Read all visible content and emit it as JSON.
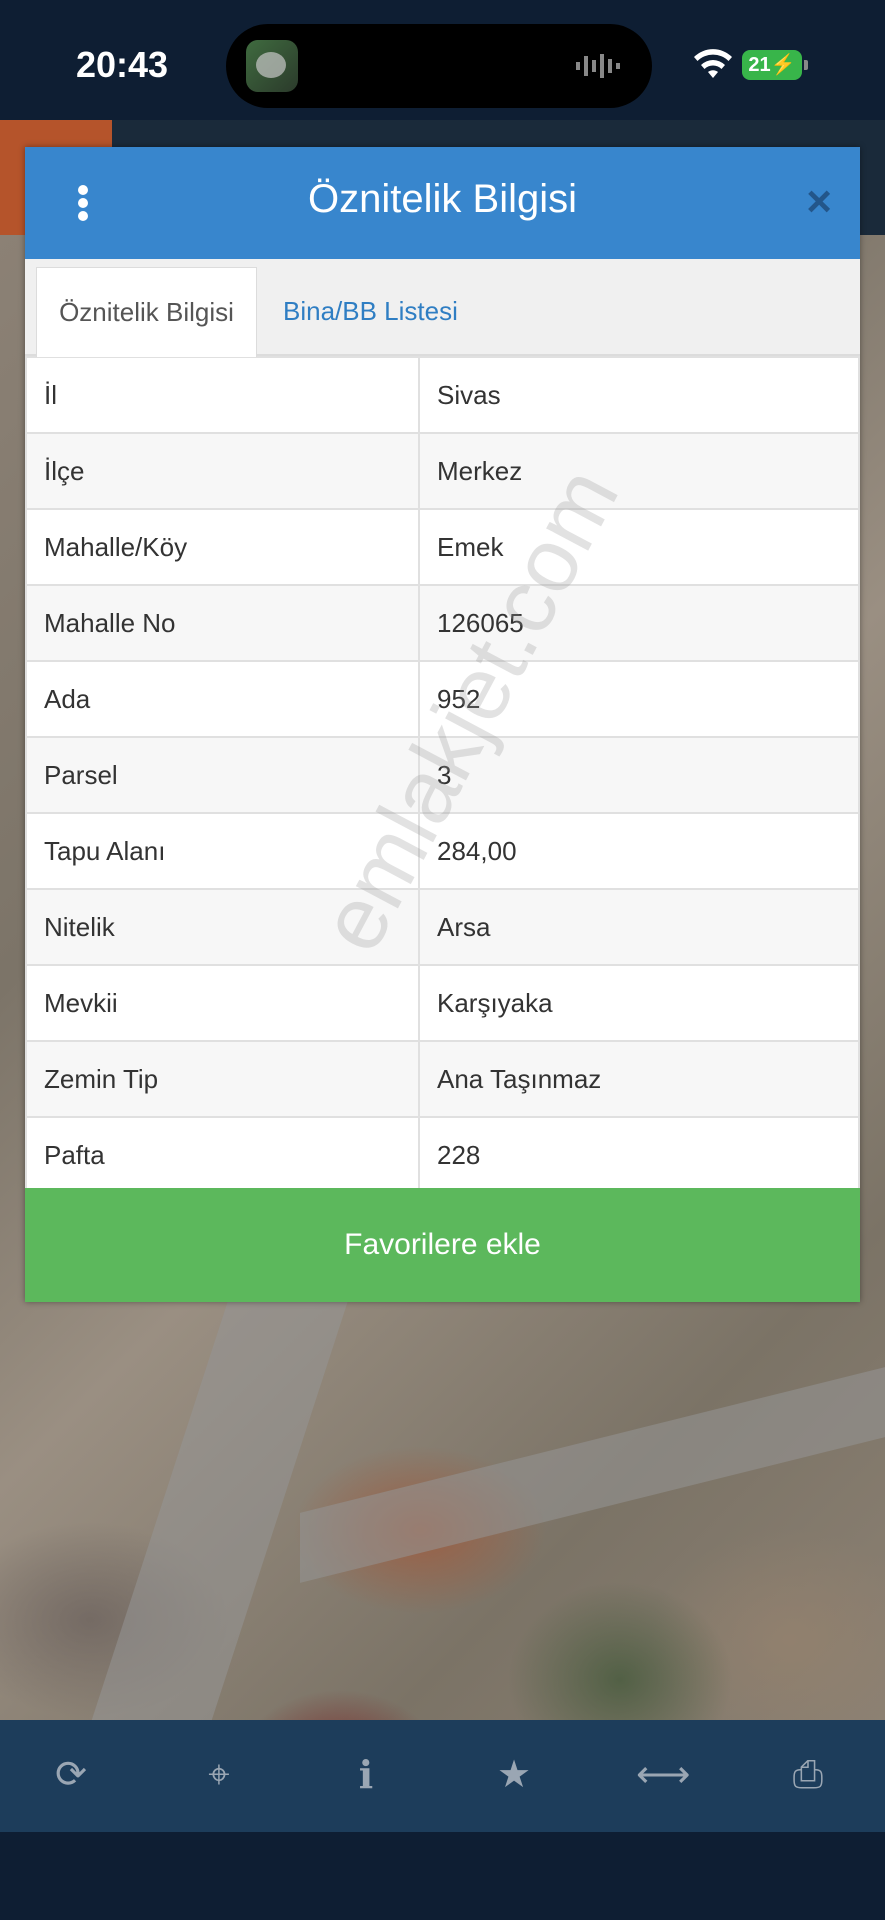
{
  "status_bar": {
    "time": "20:43",
    "battery": "21"
  },
  "modal": {
    "title": "Öznitelik Bilgisi",
    "close_icon": "×",
    "tabs": [
      {
        "label": "Öznitelik Bilgisi",
        "active": true
      },
      {
        "label": "Bina/BB Listesi",
        "active": false
      }
    ],
    "rows": [
      {
        "key": "İl",
        "value": "Sivas"
      },
      {
        "key": "İlçe",
        "value": "Merkez"
      },
      {
        "key": "Mahalle/Köy",
        "value": "Emek"
      },
      {
        "key": "Mahalle No",
        "value": "126065"
      },
      {
        "key": "Ada",
        "value": "952"
      },
      {
        "key": "Parsel",
        "value": "3"
      },
      {
        "key": "Tapu Alanı",
        "value": "284,00"
      },
      {
        "key": "Nitelik",
        "value": "Arsa"
      },
      {
        "key": "Mevkii",
        "value": "Karşıyaka"
      },
      {
        "key": "Zemin Tip",
        "value": "Ana Taşınmaz"
      },
      {
        "key": "Pafta",
        "value": "228"
      }
    ],
    "favorite_button": "Favorilere ekle"
  },
  "watermark": "emlakjet.com",
  "toolbar": {
    "items": [
      {
        "name": "refresh-icon",
        "glyph": "⟳"
      },
      {
        "name": "locate-icon",
        "glyph": "⌖"
      },
      {
        "name": "info-icon",
        "glyph": "i"
      },
      {
        "name": "star-icon",
        "glyph": "★"
      },
      {
        "name": "measure-icon",
        "glyph": "⟷"
      },
      {
        "name": "print-icon",
        "glyph": "⎙"
      }
    ]
  }
}
